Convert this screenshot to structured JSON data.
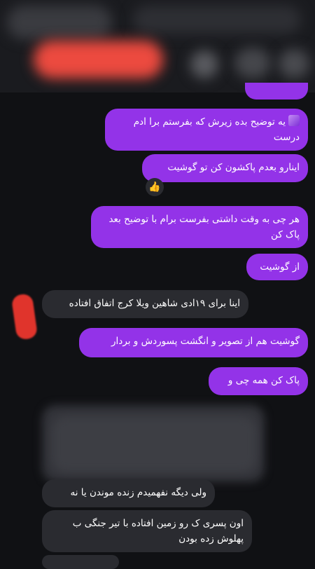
{
  "messages": {
    "m1": "یه توضیح بده زیرش که بفرستم برا ادم درست",
    "m2": "اینارو بعدم پاکشون کن تو گوشیت",
    "m2_reaction": "👍",
    "m3": "هر چی به وقت داشتی بفرست برام با توضیح بعد پاک کن",
    "m4": "از گوشیت",
    "m5": "اینا برای ۱۹ادی شاهین ویلا کرج اتفاق افتاده",
    "m6": "گوشیت هم از تصویر و انگشت پسوردش و بردار",
    "m7": "پاک کن همه چی و",
    "m8": "ولی دیگه نفهمیدم زنده موندن یا نه",
    "m9": "اون پسری ک رو زمین افتاده با تیر جنگی ب پهلوش زده بودن"
  },
  "colors": {
    "outgoing": "#9333e8",
    "incoming": "#2a2b30",
    "background": "#101114"
  }
}
